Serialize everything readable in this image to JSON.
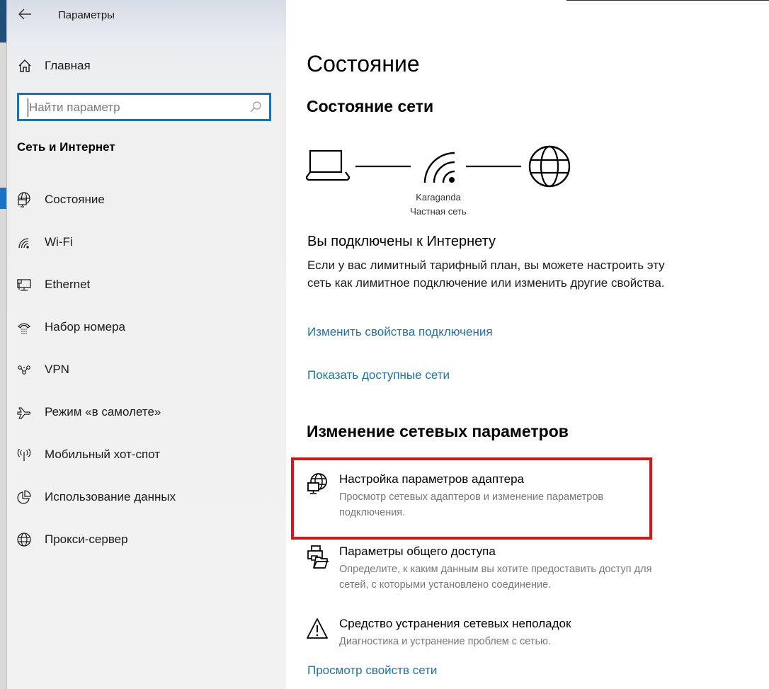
{
  "window": {
    "title": "Параметры",
    "back_label": "Назад"
  },
  "sidebar": {
    "home_label": "Главная",
    "search": {
      "placeholder": "Найти параметр",
      "value": ""
    },
    "section_title": "Сеть и Интернет",
    "items": [
      {
        "label": "Состояние",
        "icon": "network-status-icon",
        "active": true
      },
      {
        "label": "Wi-Fi",
        "icon": "wifi-icon",
        "active": false
      },
      {
        "label": "Ethernet",
        "icon": "ethernet-icon",
        "active": false
      },
      {
        "label": "Набор номера",
        "icon": "dial-up-icon",
        "active": false
      },
      {
        "label": "VPN",
        "icon": "vpn-icon",
        "active": false
      },
      {
        "label": "Режим «в самолете»",
        "icon": "airplane-icon",
        "active": false
      },
      {
        "label": "Мобильный хот-спот",
        "icon": "hotspot-icon",
        "active": false
      },
      {
        "label": "Использование данных",
        "icon": "data-usage-icon",
        "active": false
      },
      {
        "label": "Прокси-сервер",
        "icon": "globe-icon",
        "active": false
      }
    ]
  },
  "main": {
    "page_title": "Состояние",
    "network_status": {
      "heading": "Состояние сети",
      "network_name": "Karaganda",
      "network_type": "Частная сеть",
      "connected_title": "Вы подключены к Интернету",
      "connected_desc": "Если у вас лимитный тарифный план, вы можете настроить эту сеть как лимитное подключение или изменить другие свойства.",
      "links": {
        "change_properties": "Изменить свойства подключения",
        "show_networks": "Показать доступные сети"
      }
    },
    "change_settings": {
      "heading": "Изменение сетевых параметров",
      "options": [
        {
          "title": "Настройка параметров адаптера",
          "desc": "Просмотр сетевых адаптеров и изменение параметров подключения.",
          "icon": "adapter-icon",
          "highlighted": true
        },
        {
          "title": "Параметры общего доступа",
          "desc": "Определите, к каким данным вы хотите предоставить доступ для сетей, с которыми установлено соединение.",
          "icon": "sharing-icon",
          "highlighted": false
        },
        {
          "title": "Средство устранения сетевых неполадок",
          "desc": "Диагностика и устранение проблем с сетью.",
          "icon": "warning-icon",
          "highlighted": false
        }
      ],
      "view_properties_link": "Просмотр свойств сети"
    }
  },
  "colors": {
    "accent": "#1b72b5",
    "link": "#1a73b0",
    "highlight_box": "#d9141b"
  }
}
